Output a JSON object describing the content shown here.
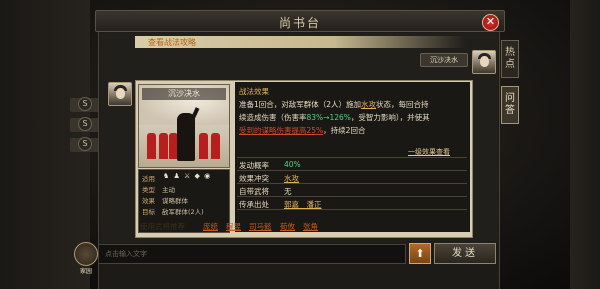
{
  "window": {
    "title": "尚书台",
    "close_label": "✕"
  },
  "link": {
    "text": "查看战法攻略"
  },
  "my_message": {
    "text": "沉沙决水"
  },
  "side_tabs": [
    {
      "label": "热点"
    },
    {
      "label": "问答"
    }
  ],
  "skill": {
    "name": "沉沙决水",
    "stats": [
      {
        "key": "适用",
        "value": ""
      },
      {
        "key": "类型",
        "value": "主动"
      },
      {
        "key": "效果",
        "value": "谋略群体"
      },
      {
        "key": "目标",
        "value": "敌军群体(2人)"
      }
    ],
    "effect_title": "战法效果",
    "effect_line1": "准备1回合，对敌军群体（2人）施加",
    "effect_line1_hl": "水攻",
    "effect_line1_tail": "状态，每回合持",
    "effect_line2_pre": "续造成伤害（伤害率",
    "effect_line2_range": "83%→126%",
    "effect_line2_tail": "，受智力影响），并使其",
    "effect_line3_hl": "受到的谋略伤害提高25%",
    "effect_line3_tail": "，持续2回合",
    "detail_link": "一级效果查看",
    "kv": [
      {
        "label": "发动概率",
        "value": "40%"
      },
      {
        "label": "效果冲突",
        "value": "水攻"
      },
      {
        "label": "自带武将",
        "value": "无"
      },
      {
        "label": "传承出处",
        "value": "郭嘉　潘正"
      }
    ],
    "users_label": "使用武将推荐",
    "users": [
      "庞统",
      "程昱",
      "司马懿",
      "荀攸",
      "张角"
    ]
  },
  "input": {
    "placeholder": "点击输入文字"
  },
  "buttons": {
    "up": "⬆",
    "send": "发送"
  },
  "home": {
    "label": "家园"
  },
  "bg_letters": [
    "S",
    "S",
    "S"
  ]
}
